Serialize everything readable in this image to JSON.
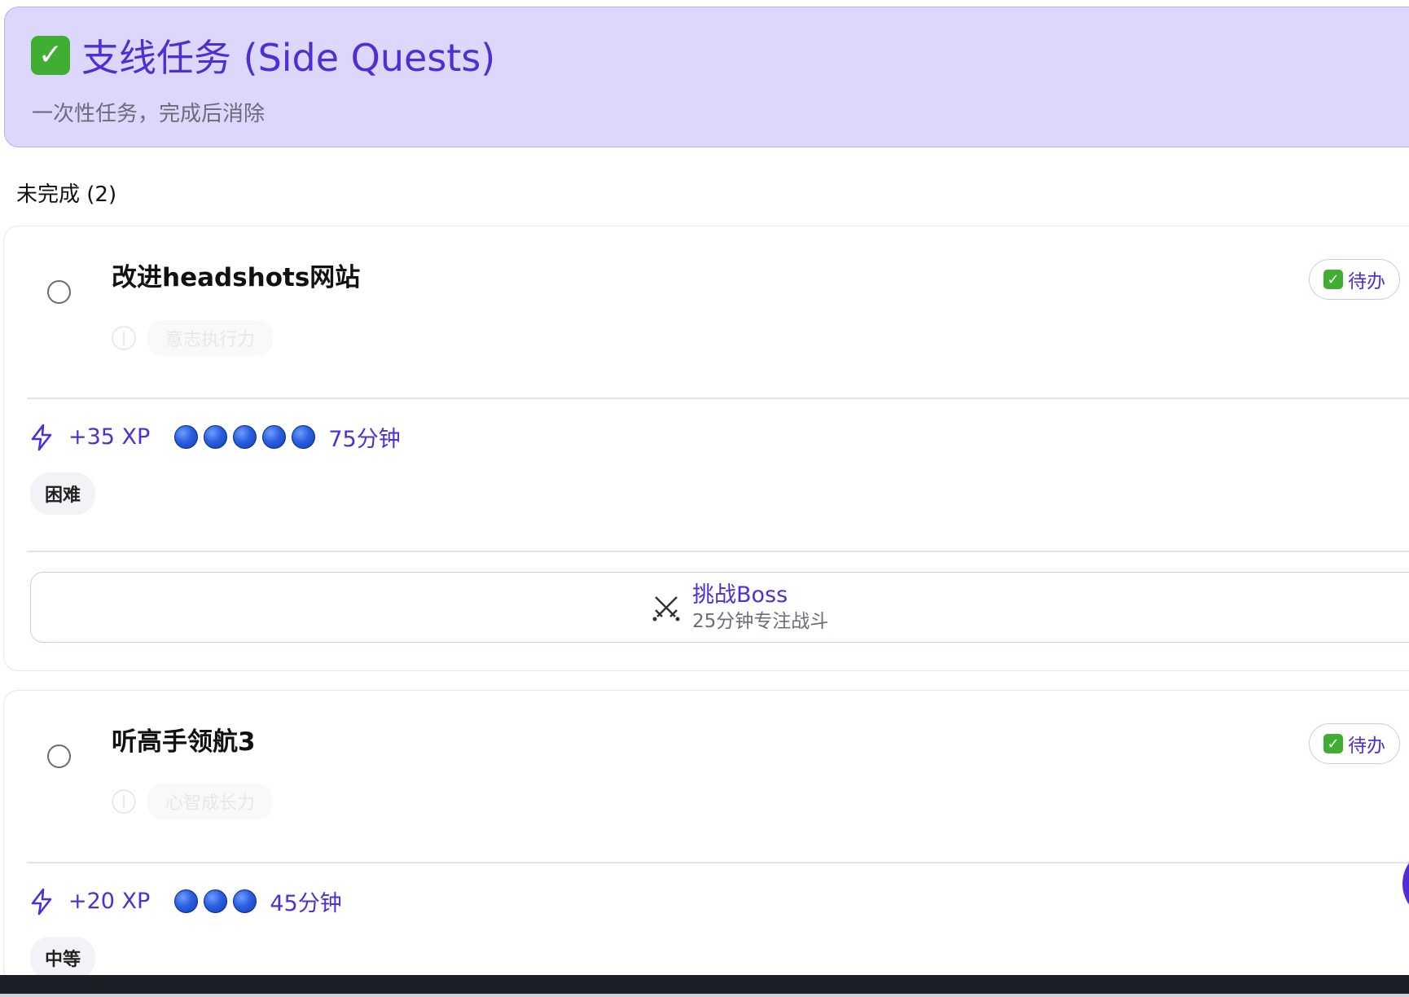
{
  "header": {
    "title": "支线任务 (Side Quests)",
    "subtitle": "一次性任务，完成后消除",
    "icon": "check-mark-emoji"
  },
  "section": {
    "label": "未完成 (2)"
  },
  "tasks": [
    {
      "title": "改进headshots网站",
      "faded_tag": "意志执行力",
      "status": "待办",
      "xp": "+35 XP",
      "dots": 5,
      "duration": "75分钟",
      "difficulty": "困难",
      "boss": {
        "title": "挑战Boss",
        "subtitle": "25分钟专注战斗",
        "icon": "crossed-swords-icon"
      }
    },
    {
      "title": "听高手领航3",
      "faded_tag": "心智成长力",
      "status": "待办",
      "xp": "+20 XP",
      "dots": 3,
      "duration": "45分钟",
      "difficulty": "中等"
    }
  ],
  "colors": {
    "accent": "#4f2ed6",
    "header_bg": "#dcd7fb",
    "check_green": "#3fae33",
    "dot_blue": "#2a5fe0"
  }
}
